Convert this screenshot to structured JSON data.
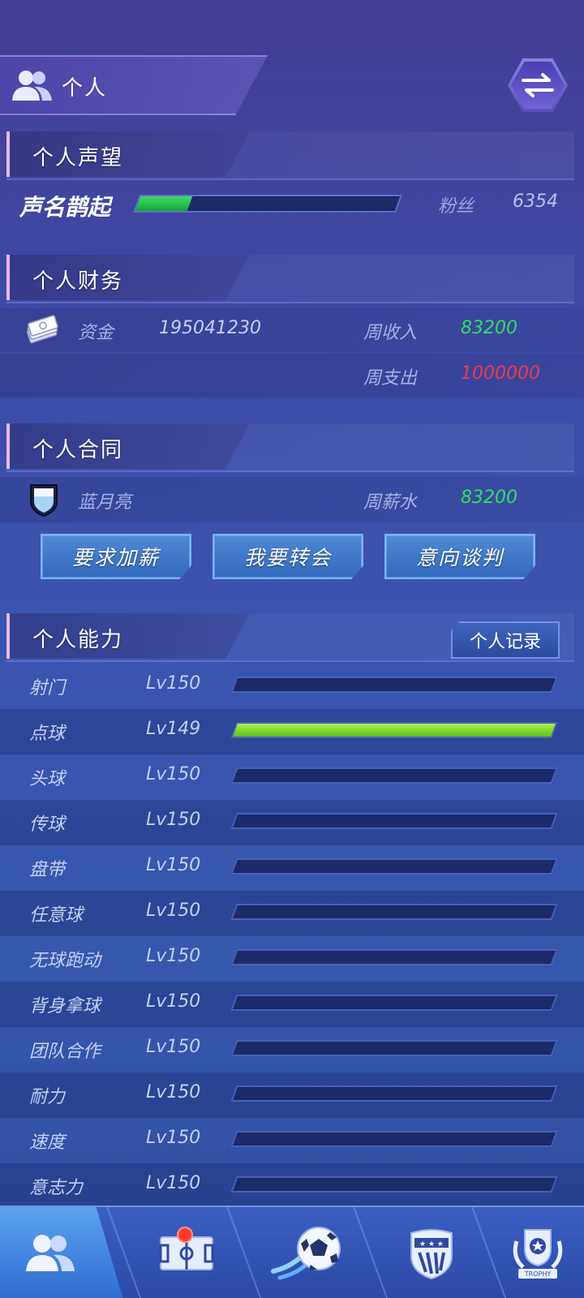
{
  "header": {
    "title": "个人"
  },
  "reputation": {
    "section_title": "个人声望",
    "level_title": "声名鹊起",
    "progress": 0.2,
    "fans_label": "粉丝",
    "fans_value": "6354"
  },
  "finance": {
    "section_title": "个人财务",
    "funds_label": "资金",
    "funds_value": "195041230",
    "weekly_income_label": "周收入",
    "weekly_income_value": "83200",
    "weekly_expense_label": "周支出",
    "weekly_expense_value": "1000000"
  },
  "contract": {
    "section_title": "个人合同",
    "club_name": "蓝月亮",
    "weekly_salary_label": "周薪水",
    "weekly_salary_value": "83200",
    "buttons": [
      "要求加薪",
      "我要转会",
      "意向谈判"
    ]
  },
  "ability": {
    "section_title": "个人能力",
    "record_button": "个人记录",
    "items": [
      {
        "name": "射门",
        "level": "Lv150",
        "progress": 0
      },
      {
        "name": "点球",
        "level": "Lv149",
        "progress": 1.0
      },
      {
        "name": "头球",
        "level": "Lv150",
        "progress": 0
      },
      {
        "name": "传球",
        "level": "Lv150",
        "progress": 0
      },
      {
        "name": "盘带",
        "level": "Lv150",
        "progress": 0
      },
      {
        "name": "任意球",
        "level": "Lv150",
        "progress": 0
      },
      {
        "name": "无球跑动",
        "level": "Lv150",
        "progress": 0
      },
      {
        "name": "背身拿球",
        "level": "Lv150",
        "progress": 0
      },
      {
        "name": "团队合作",
        "level": "Lv150",
        "progress": 0
      },
      {
        "name": "耐力",
        "level": "Lv150",
        "progress": 0
      },
      {
        "name": "速度",
        "level": "Lv150",
        "progress": 0
      },
      {
        "name": "意志力",
        "level": "Lv150",
        "progress": 0
      }
    ]
  },
  "bottom_nav": {
    "items": [
      {
        "icon": "players-icon",
        "active": true
      },
      {
        "icon": "pitch-icon",
        "badge": true
      },
      {
        "icon": "soccer-ball-icon"
      },
      {
        "icon": "club-crest-icon"
      },
      {
        "icon": "trophy-icon",
        "label": "TROPHY"
      }
    ]
  },
  "colors": {
    "accent_green": "#2ee05a",
    "accent_red": "#f0394d",
    "progress_green": "#5cc21c"
  }
}
